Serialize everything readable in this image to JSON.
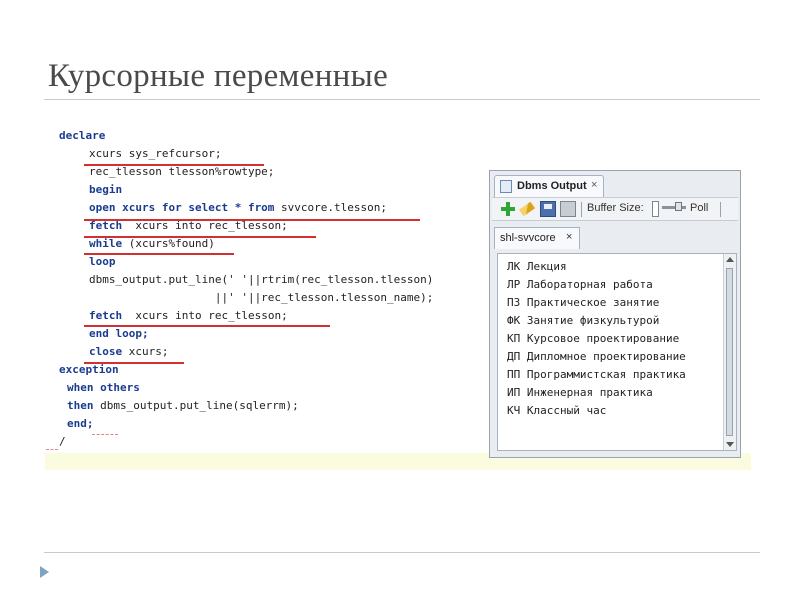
{
  "slide": {
    "title": "Курсорные переменные"
  },
  "code": {
    "lines": [
      {
        "kw": "declare",
        "rest": ""
      },
      {
        "kw": "",
        "rest": "xcurs sys_refcursor;"
      },
      {
        "kw": "",
        "rest": "rec_tlesson tlesson%rowtype;"
      },
      {
        "kw": "begin",
        "rest": ""
      },
      {
        "kw": "open xcurs for select * from",
        "rest": " svvcore.tlesson;"
      },
      {
        "kw": "fetch",
        "rest": "  xcurs into rec_tlesson;"
      },
      {
        "kw": "while",
        "rest": " (xcurs%found)"
      },
      {
        "kw": "loop",
        "rest": ""
      },
      {
        "kw": "",
        "rest": "dbms_output.put_line(' '||rtrim(rec_tlesson.tlesson)"
      },
      {
        "kw": "",
        "rest": "                   ||' '||rec_tlesson.tlesson_name);"
      },
      {
        "kw": "fetch",
        "rest": "  xcurs into rec_tlesson;"
      },
      {
        "kw": "end loop;",
        "rest": ""
      },
      {
        "kw": "close",
        "rest": " xcurs;"
      },
      {
        "kw": "exception",
        "rest": ""
      },
      {
        "kw": "when others",
        "rest": ""
      },
      {
        "kw": "then",
        "rest": " dbms_output.put_line(sqlerrm);"
      },
      {
        "kw": "end;",
        "rest": ""
      },
      {
        "kw": "",
        "rest": "/"
      }
    ]
  },
  "dbms_panel": {
    "tab_label": "Dbms Output",
    "tab_close": "×",
    "buffer_size_label": "Buffer Size:",
    "poll_label": "Poll",
    "connection_tab": "shl-svvcore",
    "connection_close": "×",
    "output": [
      "ЛК Лекция",
      "ЛР Лабораторная работа",
      "ПЗ Практическое занятие",
      "ФК Занятие физкультурой",
      "КП Курсовое проектирование",
      "ДП Дипломное проектирование",
      "ПП Программистская практика",
      "ИП Инженерная практика",
      "КЧ Классный час"
    ]
  },
  "colors": {
    "keyword": "#1a3c8e",
    "underline": "#d23131",
    "bullet": "#7ea4c4"
  }
}
